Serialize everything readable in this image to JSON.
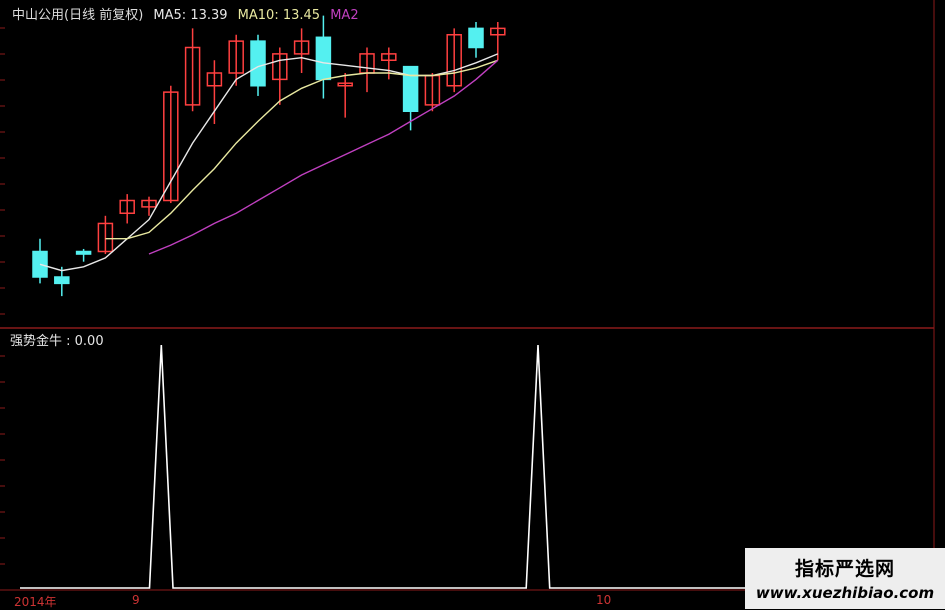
{
  "header": {
    "title": "中山公用(日线 前复权)",
    "ma5_label": "MA5: 13.39",
    "ma10_label": "MA10: 13.45",
    "ma20_label": "MA2"
  },
  "indicator": {
    "label": "强势金牛 : 0.00"
  },
  "watermark": {
    "line1": "指标严选网",
    "line2": "www.xuezhibiao.com"
  },
  "x_labels": {
    "year": "2014年",
    "m1": "9",
    "m2": "10"
  },
  "colors": {
    "background": "#000000",
    "up": "#ff4040",
    "down": "#54f0f0",
    "ma5": "#e8e8e8",
    "ma10": "#e8e8a0",
    "ma20": "#c040c0",
    "ma60": "#40b040",
    "grid": "#8b1a1a",
    "indicator": "#ffffff"
  },
  "chart_data": [
    {
      "type": "candlestick",
      "title": "中山公用(日线 前复权)",
      "series_names": [
        "MA5",
        "MA10",
        "MA2"
      ],
      "ylim": [
        11.6,
        14.0
      ],
      "candles": [
        {
          "o": 12.2,
          "h": 12.3,
          "l": 11.95,
          "c": 12.0
        },
        {
          "o": 12.0,
          "h": 12.08,
          "l": 11.85,
          "c": 11.95
        },
        {
          "o": 12.2,
          "h": 12.22,
          "l": 12.12,
          "c": 12.18
        },
        {
          "o": 12.2,
          "h": 12.48,
          "l": 12.18,
          "c": 12.42
        },
        {
          "o": 12.5,
          "h": 12.65,
          "l": 12.42,
          "c": 12.6
        },
        {
          "o": 12.55,
          "h": 12.63,
          "l": 12.48,
          "c": 12.6
        },
        {
          "o": 12.6,
          "h": 13.5,
          "l": 12.58,
          "c": 13.45
        },
        {
          "o": 13.35,
          "h": 13.95,
          "l": 13.3,
          "c": 13.8
        },
        {
          "o": 13.5,
          "h": 13.7,
          "l": 13.2,
          "c": 13.6
        },
        {
          "o": 13.6,
          "h": 13.9,
          "l": 13.5,
          "c": 13.85
        },
        {
          "o": 13.85,
          "h": 13.9,
          "l": 13.42,
          "c": 13.5
        },
        {
          "o": 13.55,
          "h": 13.8,
          "l": 13.35,
          "c": 13.75
        },
        {
          "o": 13.75,
          "h": 13.95,
          "l": 13.6,
          "c": 13.85
        },
        {
          "o": 13.88,
          "h": 14.05,
          "l": 13.4,
          "c": 13.55
        },
        {
          "o": 13.5,
          "h": 13.6,
          "l": 13.25,
          "c": 13.52
        },
        {
          "o": 13.6,
          "h": 13.8,
          "l": 13.45,
          "c": 13.75
        },
        {
          "o": 13.7,
          "h": 13.8,
          "l": 13.55,
          "c": 13.75
        },
        {
          "o": 13.65,
          "h": 13.65,
          "l": 13.15,
          "c": 13.3
        },
        {
          "o": 13.35,
          "h": 13.6,
          "l": 13.3,
          "c": 13.58
        },
        {
          "o": 13.5,
          "h": 13.95,
          "l": 13.45,
          "c": 13.9
        },
        {
          "o": 13.95,
          "h": 14.0,
          "l": 13.72,
          "c": 13.8
        },
        {
          "o": 13.9,
          "h": 14.0,
          "l": 13.7,
          "c": 13.95
        }
      ],
      "ma5": [
        12.1,
        12.05,
        12.08,
        12.15,
        12.3,
        12.45,
        12.75,
        13.05,
        13.3,
        13.55,
        13.65,
        13.7,
        13.72,
        13.68,
        13.66,
        13.64,
        13.62,
        13.58,
        13.58,
        13.62,
        13.68,
        13.75
      ],
      "ma10": [
        null,
        null,
        null,
        12.3,
        12.3,
        12.35,
        12.5,
        12.68,
        12.85,
        13.05,
        13.22,
        13.38,
        13.48,
        13.55,
        13.58,
        13.6,
        13.6,
        13.58,
        13.58,
        13.6,
        13.64,
        13.7
      ],
      "ma20": [
        null,
        null,
        null,
        null,
        null,
        12.18,
        12.25,
        12.33,
        12.42,
        12.5,
        12.6,
        12.7,
        12.8,
        12.88,
        12.96,
        13.04,
        13.12,
        13.22,
        13.32,
        13.42,
        13.55,
        13.7
      ]
    },
    {
      "type": "line",
      "title": "强势金牛",
      "ylim": [
        0,
        1
      ],
      "x": [
        0,
        5.5,
        6,
        6.5,
        21.5,
        22,
        22.5,
        38
      ],
      "values": [
        0,
        0,
        1,
        0,
        0,
        1,
        0,
        0
      ]
    }
  ]
}
